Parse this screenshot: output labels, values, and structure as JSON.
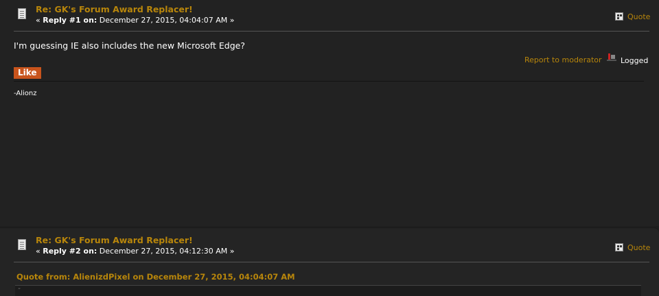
{
  "posts": [
    {
      "subject": "Re: GK's Forum Award Replacer!",
      "meta_prefix": "« ",
      "reply_label": "Reply #1 on:",
      "date": " December 27, 2015, 04:04:07 AM »",
      "quote_label": "Quote",
      "body": "I'm guessing IE also includes the new Microsoft Edge?",
      "report_label": "Report to moderator",
      "logged_label": "Logged",
      "like_label": "Like",
      "signature": "-Alionz"
    },
    {
      "subject": "Re: GK's Forum Award Replacer!",
      "meta_prefix": "« ",
      "reply_label": "Reply #2 on:",
      "date": " December 27, 2015, 04:12:30 AM »",
      "quote_label": "Quote",
      "quote_header": "Quote from: AlienizdPixel on December 27, 2015, 04:04:07 AM",
      "quote_mark": "“"
    }
  ],
  "colors": {
    "accent": "#b8860b",
    "like_bg": "#c8541c",
    "background": "#222222"
  }
}
